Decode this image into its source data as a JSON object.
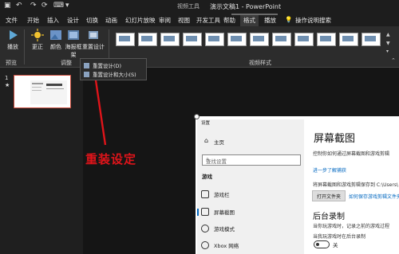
{
  "titlebar": {
    "qat": [
      "↶",
      "↷",
      "⟳",
      "⌨",
      "▾"
    ],
    "context_label": "视频工具",
    "doc_title": "演示文稿1 - PowerPoint"
  },
  "tabs": [
    "文件",
    "开始",
    "插入",
    "设计",
    "切换",
    "动画",
    "幻灯片放映",
    "审阅",
    "视图",
    "开发工具",
    "帮助",
    "格式",
    "播放"
  ],
  "tell_me": "操作说明搜索",
  "ribbon": {
    "play": "播放",
    "corrections": "更正",
    "color": "颜色",
    "poster_frame": "海报框架",
    "reset_design": "重置设计",
    "group_preview": "预览",
    "group_adjust": "调整",
    "group_video_styles": "视频样式"
  },
  "dropdown": {
    "item1": "重置设计(D)",
    "item2": "重置设计和大小(S)"
  },
  "slides": {
    "number": "1",
    "star": "★"
  },
  "settings": {
    "window_title": "设置",
    "home": "主页",
    "search_placeholder": "查找设置",
    "category": "游戏",
    "items": [
      "游戏栏",
      "屏幕截图",
      "游戏模式",
      "Xbox 网络"
    ]
  },
  "content": {
    "title": "屏幕截图",
    "desc": "控制你如何通过屏幕截图和游戏剪辑",
    "learn_more": "进一步了解捕获",
    "save_path": "将屏幕截图和游戏剪辑保存到 C:\\Users\\",
    "open_folder": "打开文件夹",
    "change_location": "如何保存游戏剪辑文件夹",
    "bg_title": "后台录制",
    "bg_desc": "当你玩游戏时，记录之前的游戏过程",
    "record_label": "当我玩游戏时在后台录制",
    "toggle": "关"
  },
  "annotation": "重装设定",
  "colors": {
    "annotation": "#e0141a",
    "accent_link": "#0067c0"
  }
}
